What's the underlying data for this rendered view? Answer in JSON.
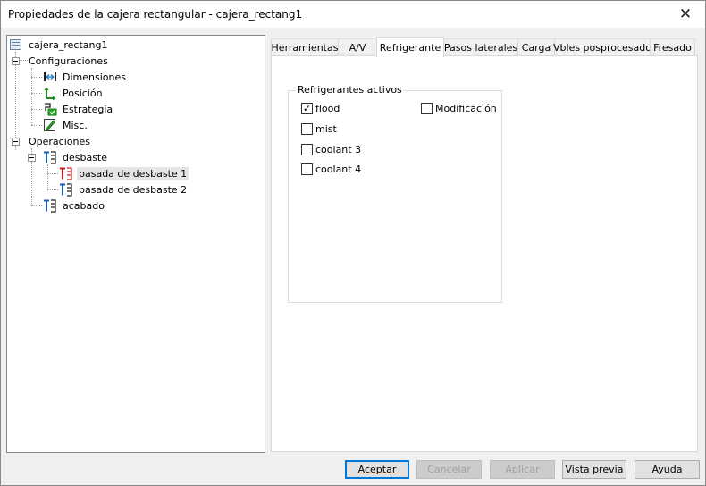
{
  "window": {
    "title": "Propiedades de la cajera rectangular - cajera_rectang1",
    "close_glyph": "✕"
  },
  "tree": {
    "root": "cajera_rectang1",
    "configuraciones": "Configuraciones",
    "config_items": [
      "Dimensiones",
      "Posición",
      "Estrategia",
      "Misc."
    ],
    "operaciones": "Operaciones",
    "desbaste": "desbaste",
    "desbaste_items": [
      "pasada de desbaste 1",
      "pasada de desbaste 2"
    ],
    "acabado": "acabado",
    "selected": "pasada de desbaste 1"
  },
  "tabs": [
    "Herramientas",
    "A/V",
    "Refrigerante",
    "Pasos laterales",
    "Carga",
    "Vbles posprocesado",
    "Fresado"
  ],
  "active_tab": "Refrigerante",
  "coolant": {
    "group_label": "Refrigerantes activos",
    "items": [
      {
        "label": "flood",
        "checked": true
      },
      {
        "label": "mist",
        "checked": false
      },
      {
        "label": "coolant 3",
        "checked": false
      },
      {
        "label": "coolant 4",
        "checked": false
      }
    ],
    "modificacion": {
      "label": "Modificación",
      "checked": false
    },
    "check_glyph": "✓"
  },
  "buttons": {
    "accept": "Aceptar",
    "cancel": "Cancelar",
    "apply": "Aplicar",
    "preview": "Vista previa",
    "help": "Ayuda"
  },
  "colors": {
    "accent": "#0078d7",
    "tool_red": "#d01818",
    "tool_blue": "#1c5fb0",
    "check_green": "#2aa82a"
  }
}
